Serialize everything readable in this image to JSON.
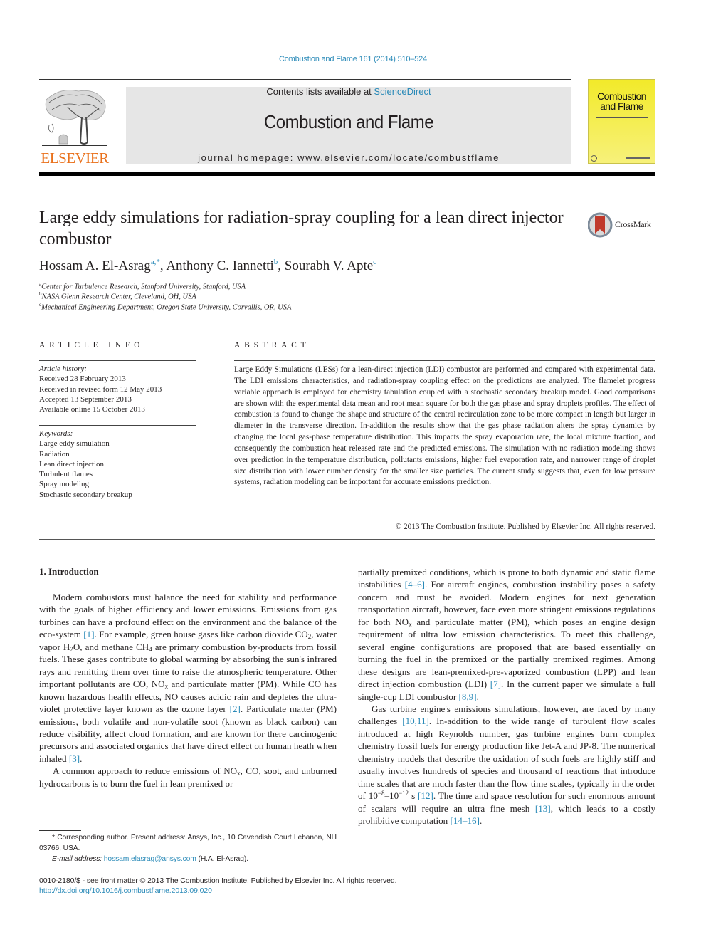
{
  "journal_reference": "Combustion and Flame 161 (2014) 510–524",
  "masthead": {
    "contents_prefix": "Contents lists available at ",
    "contents_link": "ScienceDirect",
    "journal_name": "Combustion and Flame",
    "homepage": "journal homepage: www.elsevier.com/locate/combustflame",
    "publisher_logo_text": "ELSEVIER",
    "cover_title_line1": "Combustion",
    "cover_title_line2": "and Flame"
  },
  "crossmark_label": "CrossMark",
  "article": {
    "title": "Large eddy simulations for radiation-spray coupling for a lean direct injector combustor",
    "authors": [
      {
        "name": "Hossam A. El-Asrag",
        "marks": "a,*"
      },
      {
        "name": "Anthony C. Iannetti",
        "marks": "b"
      },
      {
        "name": "Sourabh V. Apte",
        "marks": "c"
      }
    ],
    "affiliations": [
      {
        "mark": "a",
        "text": "Center for Turbulence Research, Stanford University, Stanford, USA"
      },
      {
        "mark": "b",
        "text": "NASA Glenn Research Center, Cleveland, OH, USA"
      },
      {
        "mark": "c",
        "text": "Mechanical Engineering Department, Oregon State University, Corvallis, OR, USA"
      }
    ]
  },
  "article_info": {
    "heading": "ARTICLE INFO",
    "history_label": "Article history:",
    "history": [
      "Received 28 February 2013",
      "Received in revised form 12 May 2013",
      "Accepted 13 September 2013",
      "Available online 15 October 2013"
    ],
    "keywords_label": "Keywords:",
    "keywords": [
      "Large eddy simulation",
      "Radiation",
      "Lean direct injection",
      "Turbulent flames",
      "Spray modeling",
      "Stochastic secondary breakup"
    ]
  },
  "abstract": {
    "heading": "ABSTRACT",
    "text": "Large Eddy Simulations (LESs) for a lean-direct injection (LDI) combustor are performed and compared with experimental data. The LDI emissions characteristics, and radiation-spray coupling effect on the predictions are analyzed. The flamelet progress variable approach is employed for chemistry tabulation coupled with a stochastic secondary breakup model. Good comparisons are shown with the experimental data mean and root mean square for both the gas phase and spray droplets profiles. The effect of combustion is found to change the shape and structure of the central recirculation zone to be more compact in length but larger in diameter in the transverse direction. In-addition the results show that the gas phase radiation alters the spray dynamics by changing the local gas-phase temperature distribution. This impacts the spray evaporation rate, the local mixture fraction, and consequently the combustion heat released rate and the predicted emissions. The simulation with no radiation modeling shows over prediction in the temperature distribution, pollutants emissions, higher fuel evaporation rate, and narrower range of droplet size distribution with lower number density for the smaller size particles. The current study suggests that, even for low pressure systems, radiation modeling can be important for accurate emissions prediction.",
    "copyright": "© 2013 The Combustion Institute. Published by Elsevier Inc. All rights reserved."
  },
  "introduction": {
    "heading": "1. Introduction",
    "p1": {
      "a": "Modern combustors must balance the need for stability and performance with the goals of higher efficiency and lower emissions. Emissions from gas turbines can have a profound effect on the environment and the balance of the eco-system ",
      "c1": "[1]",
      "b": ". For example, green house gases like carbon dioxide CO",
      "b_sub": "2",
      "c": ", water vapor H",
      "c_sub": "2",
      "d": "O, and methane CH",
      "d_sub": "4",
      "e": " are primary combustion by-products from fossil fuels. These gases contribute to global warming by absorbing the sun's infrared rays and remitting them over time to raise the atmospheric temperature. Other important pollutants are CO, NO",
      "e_sub": "x",
      "f": " and particulate matter (PM). While CO has known hazardous health effects, NO causes acidic rain and depletes the ultra-violet protective layer known as the ozone layer ",
      "c2": "[2]",
      "g": ". Particulate matter (PM) emissions, both volatile and non-volatile soot (known as black carbon) can reduce visibility, affect cloud formation, and are known for there carcinogenic precursors and associated organics that have direct effect on human heath when inhaled ",
      "c3": "[3]",
      "h": "."
    },
    "p2": {
      "a": "A common approach to reduce emissions of NO",
      "a_sub": "x",
      "b": ", CO, soot, and unburned hydrocarbons is to burn the fuel in lean premixed or partially premixed conditions, which is prone to both dynamic and static flame instabilities ",
      "c1": "[4–6]",
      "c": ". For aircraft engines, combustion instability poses a safety concern and must be avoided. Modern engines for next generation transportation aircraft, however, face even more stringent emissions regulations for both NO",
      "c_sub": "x",
      "d": " and particulate matter (PM), which poses an engine design requirement of ultra low emission characteristics. To meet this challenge, several engine configurations are proposed that are based essentially on burning the fuel in the premixed or the partially premixed regimes. Among these designs are lean-premixed-pre-vaporized combustion (LPP) and lean direct injection combustion (LDI) ",
      "c2": "[7]",
      "e": ". In the current paper we simulate a full single-cup LDI combustor ",
      "c3": "[8,9]",
      "f": "."
    },
    "p3": {
      "a": "Gas turbine engine's emissions simulations, however, are faced by many challenges ",
      "c1": "[10,11]",
      "b": ". In-addition to the wide range of turbulent flow scales introduced at high Reynolds number, gas turbine engines burn complex chemistry fossil fuels for energy production like Jet-A and JP-8. The numerical chemistry models that describe the oxidation of such fuels are highly stiff and usually involves hundreds of species and thousand of reactions that introduce time scales that are much faster than the flow time scales, typically in the order of 10",
      "b_sup": "−8",
      "c": "–10",
      "c_sup": "−12",
      "d": " s ",
      "c2": "[12]",
      "e": ". The time and space resolution for such enormous amount of scalars will require an ultra fine mesh ",
      "c3": "[13]",
      "f": ", which leads to a costly prohibitive computation ",
      "c4": "[14–16]",
      "g": "."
    }
  },
  "footnote": {
    "corresponding": "* Corresponding author. Present address: Ansys, Inc., 10 Cavendish Court Lebanon, NH 03766, USA.",
    "email_label": "E-mail address: ",
    "email": "hossam.elasrag@ansys.com",
    "email_suffix": " (H.A. El-Asrag)."
  },
  "front_matter": {
    "issn_line": "0010-2180/$ - see front matter © 2013 The Combustion Institute. Published by Elsevier Inc. All rights reserved.",
    "doi": "http://dx.doi.org/10.1016/j.combustflame.2013.09.020"
  },
  "colors": {
    "link": "#2a8ab8",
    "elsevier_orange": "#e9711c",
    "masthead_gray": "#e6e6e6",
    "cover_yellow": "#f2ea2a",
    "crossmark_red": "#c0392b"
  }
}
